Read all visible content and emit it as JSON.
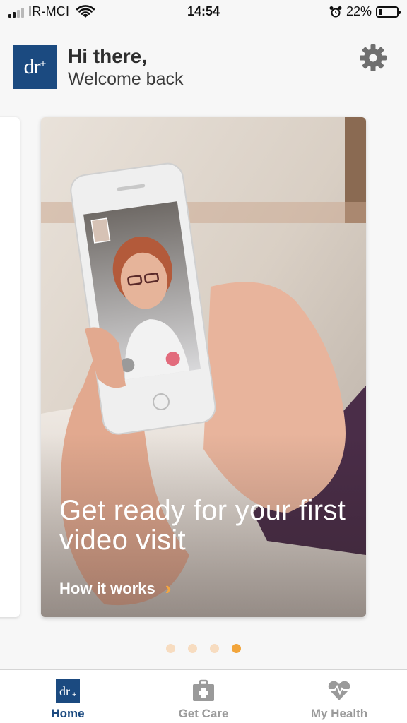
{
  "status_bar": {
    "carrier": "IR-MCI",
    "time": "14:54",
    "battery_percent_text": "22%",
    "battery_level": 0.22,
    "icons": [
      "signal-icon",
      "wifi-icon",
      "alarm-icon",
      "battery-icon"
    ]
  },
  "header": {
    "logo_text": "dr",
    "logo_plus": "+",
    "greeting": "Hi there,",
    "subtitle": "Welcome back",
    "settings_icon": "gear-icon"
  },
  "carousel": {
    "card": {
      "title": "Get ready for your first video visit",
      "link_label": "How it works",
      "link_icon": "chevron-right-icon"
    },
    "page_count": 4,
    "active_index": 3
  },
  "tab_bar": {
    "tabs": [
      {
        "label": "Home",
        "icon": "home-logo-icon",
        "active": true
      },
      {
        "label": "Get Care",
        "icon": "medical-kit-icon",
        "active": false
      },
      {
        "label": "My Health",
        "icon": "heart-pulse-icon",
        "active": false
      }
    ]
  },
  "colors": {
    "brand": "#1b4a80",
    "accent": "#f2a53b",
    "inactive": "#9a9a9a"
  }
}
